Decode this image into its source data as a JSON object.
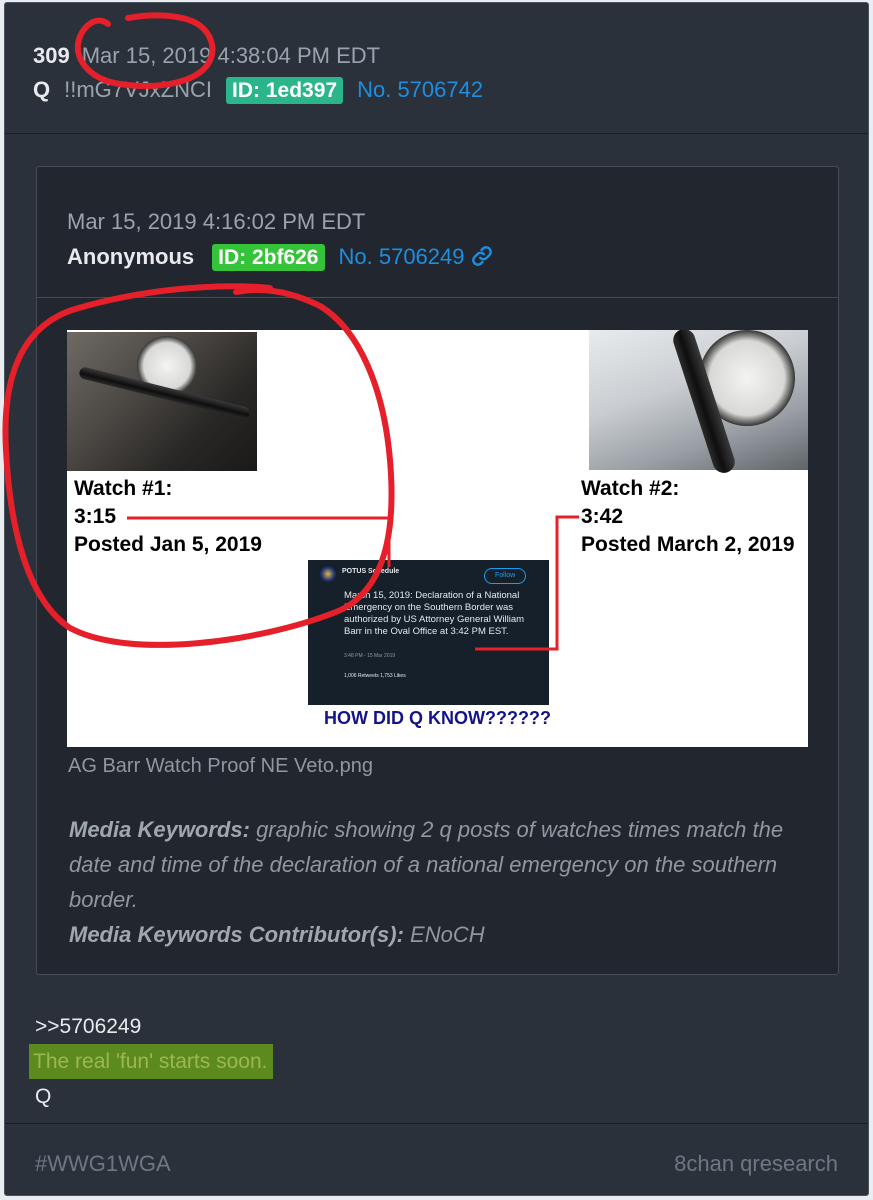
{
  "post": {
    "number": "309",
    "date": "Mar 15, 2019 4:38:04 PM EDT",
    "author": "Q",
    "tripcode": "!!mG7VJxZNCI",
    "id_label": "ID: 1ed397",
    "post_no": "No. 5706742"
  },
  "quoted": {
    "date": "Mar 15, 2019 4:16:02 PM EDT",
    "author": "Anonymous",
    "id_label": "ID: 2bf626",
    "post_no": "No. 5706249",
    "image": {
      "watch1": {
        "title": "Watch #1:",
        "time": "3:15",
        "posted": "Posted Jan 5, 2019"
      },
      "watch2": {
        "title": "Watch #2:",
        "time": "3:42",
        "posted": "Posted March 2, 2019"
      },
      "tweet": {
        "user": "POTUS Schedule",
        "follow": "Follow",
        "body": "March 15, 2019: Declaration of a National Emergency on the Southern Border was authorized by US Attorney General William Barr in the Oval Office at 3:42 PM EST.",
        "meta": "3:48 PM - 15 Mar 2019",
        "stats": "1,006 Retweets   1,753 Likes"
      },
      "caption": "HOW DID Q KNOW??????"
    },
    "filename": "AG Barr Watch Proof NE Veto.png",
    "keywords_label": "Media Keywords:",
    "keywords_text": "graphic showing 2 q posts of watches times match the date and time of the declaration of a national emergency on the southern border.",
    "contributor_label": "Media Keywords Contributor(s):",
    "contributor_text": "ENoCH"
  },
  "message": {
    "reply_ref": ">>5706249",
    "greentext": "The real 'fun' starts soon.",
    "signature": "Q"
  },
  "footer": {
    "hashtag": "#WWG1WGA",
    "source": "8chan qresearch"
  },
  "colors": {
    "id_badge_q": "#2bb58a",
    "id_badge_anon": "#35c33a",
    "link": "#1e8ee0",
    "annotation": "#e5202a"
  }
}
